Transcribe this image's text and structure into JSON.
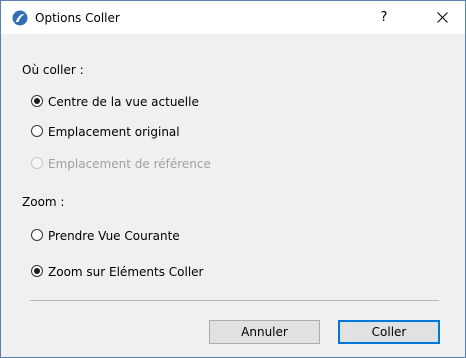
{
  "window": {
    "title": "Options Coller",
    "help_label": "?",
    "icon": "archicad-app-icon",
    "close_icon": "close-icon"
  },
  "where_section": {
    "label": "Où coller :",
    "options": [
      {
        "label": "Centre de la vue actuelle",
        "selected": true,
        "enabled": true
      },
      {
        "label": "Emplacement original",
        "selected": false,
        "enabled": true
      },
      {
        "label": "Emplacement de référence",
        "selected": false,
        "enabled": false
      }
    ]
  },
  "zoom_section": {
    "label": "Zoom :",
    "options": [
      {
        "label": "Prendre Vue Courante",
        "selected": false,
        "enabled": true
      },
      {
        "label": "Zoom sur Eléments Coller",
        "selected": true,
        "enabled": true
      }
    ]
  },
  "buttons": {
    "cancel_label": "Annuler",
    "ok_label": "Coller"
  },
  "colors": {
    "accent": "#0078d7",
    "dialog_bg": "#f0f0f0",
    "disabled_text": "#a0a0a0"
  }
}
